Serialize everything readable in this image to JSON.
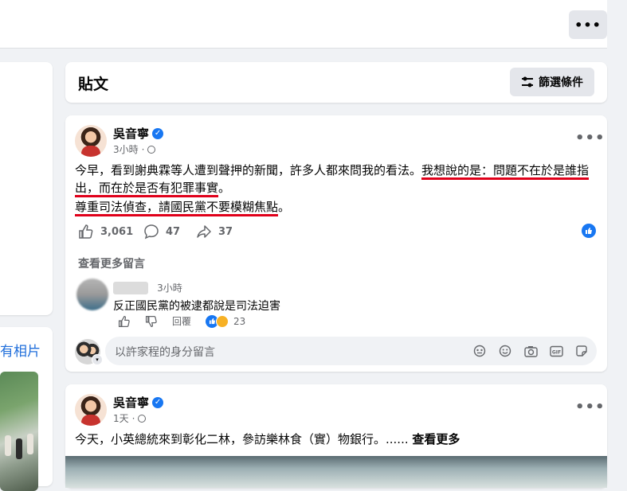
{
  "header": {
    "more_icon": "more-horizontal-icon"
  },
  "left": {
    "photos_label": "有相片"
  },
  "posts_section": {
    "title": "貼文",
    "filter_label": "篩選條件",
    "filter_icon": "sliders-icon"
  },
  "post1": {
    "author": "吳音寧",
    "time": "3小時",
    "text_lines": {
      "l1_a": "今早，看到謝典霖等人遭到聲押的新聞，許多人都來問我的看法。",
      "l1_b": "我想說的是：問題不在於是誰指",
      "l2": "出，而在於是否有犯罪事實",
      "l2_end": "。",
      "l3": "尊重司法偵查，請國民黨不要模糊焦點",
      "l3_end": "。"
    },
    "likes": "3,061",
    "comments": "47",
    "shares": "37",
    "view_more": "查看更多留言",
    "comment": {
      "time": "3小時",
      "text": "反正國民黨的被逮都說是司法迫害",
      "reply_label": "回覆",
      "reaction_count": "23"
    },
    "reply_placeholder": "以許家程的身分留言"
  },
  "post2": {
    "author": "吳音寧",
    "time": "1天",
    "text": "今天，小英總統來到彰化二林，參訪樂林食（實）物銀行。......",
    "see_more": "查看更多"
  },
  "colors": {
    "accent": "#1877f2",
    "underline": "#e0001a",
    "background": "#f0f2f5"
  }
}
